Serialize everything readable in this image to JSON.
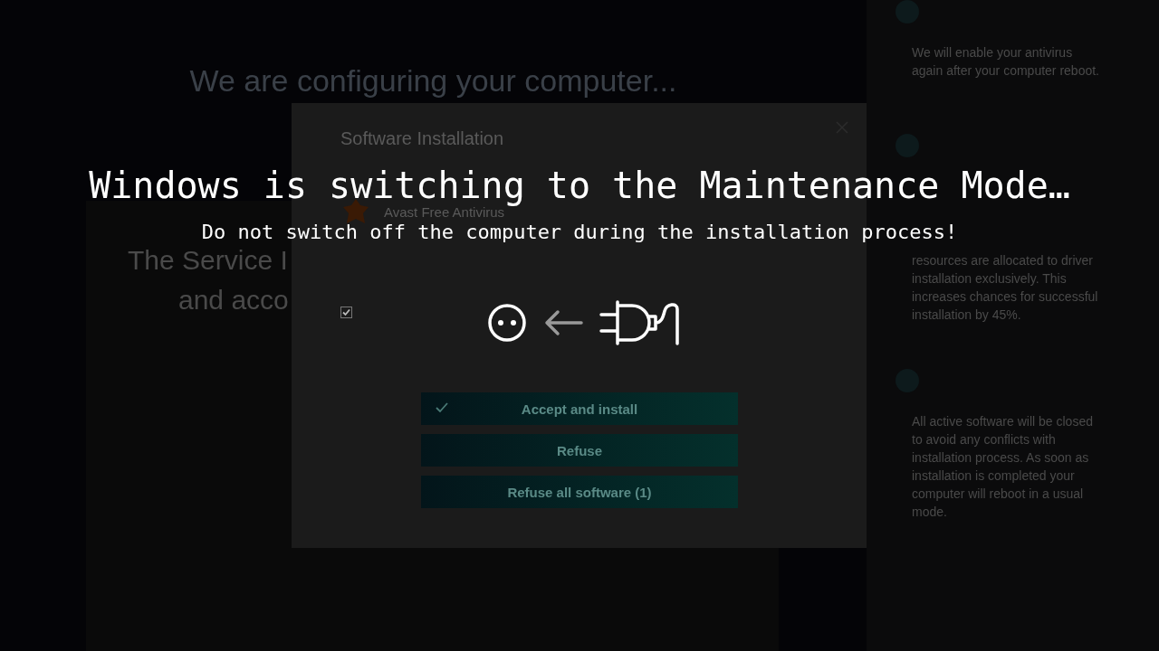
{
  "page": {
    "heading": "We are configuring your computer...",
    "panel_lines": [
      "The Service I",
      "and acco"
    ]
  },
  "dialog": {
    "title": "Software Installation",
    "product": "Avast Free Antivirus",
    "agree": {
      "checked": true
    },
    "buttons": [
      {
        "label": "Accept and install",
        "checkmark": true
      },
      {
        "label": "Refuse",
        "checkmark": false
      },
      {
        "label": "Refuse all software (1)",
        "checkmark": false
      }
    ]
  },
  "sidebar": {
    "messages": [
      {
        "text": "We will enable your antivirus again after your computer reboot."
      },
      {
        "text": "resources are allocated to driver installation exclusively. This increases chances for successful installation by 45%."
      },
      {
        "text": "All active software will be closed to avoid any conflicts with installation process. As soon as installation is completed your computer will reboot in a usual mode."
      }
    ]
  },
  "overlay": {
    "title": "Windows is switching to the Maintenance Mode…",
    "subtitle": "Do not switch off the computer during the installation process!"
  }
}
